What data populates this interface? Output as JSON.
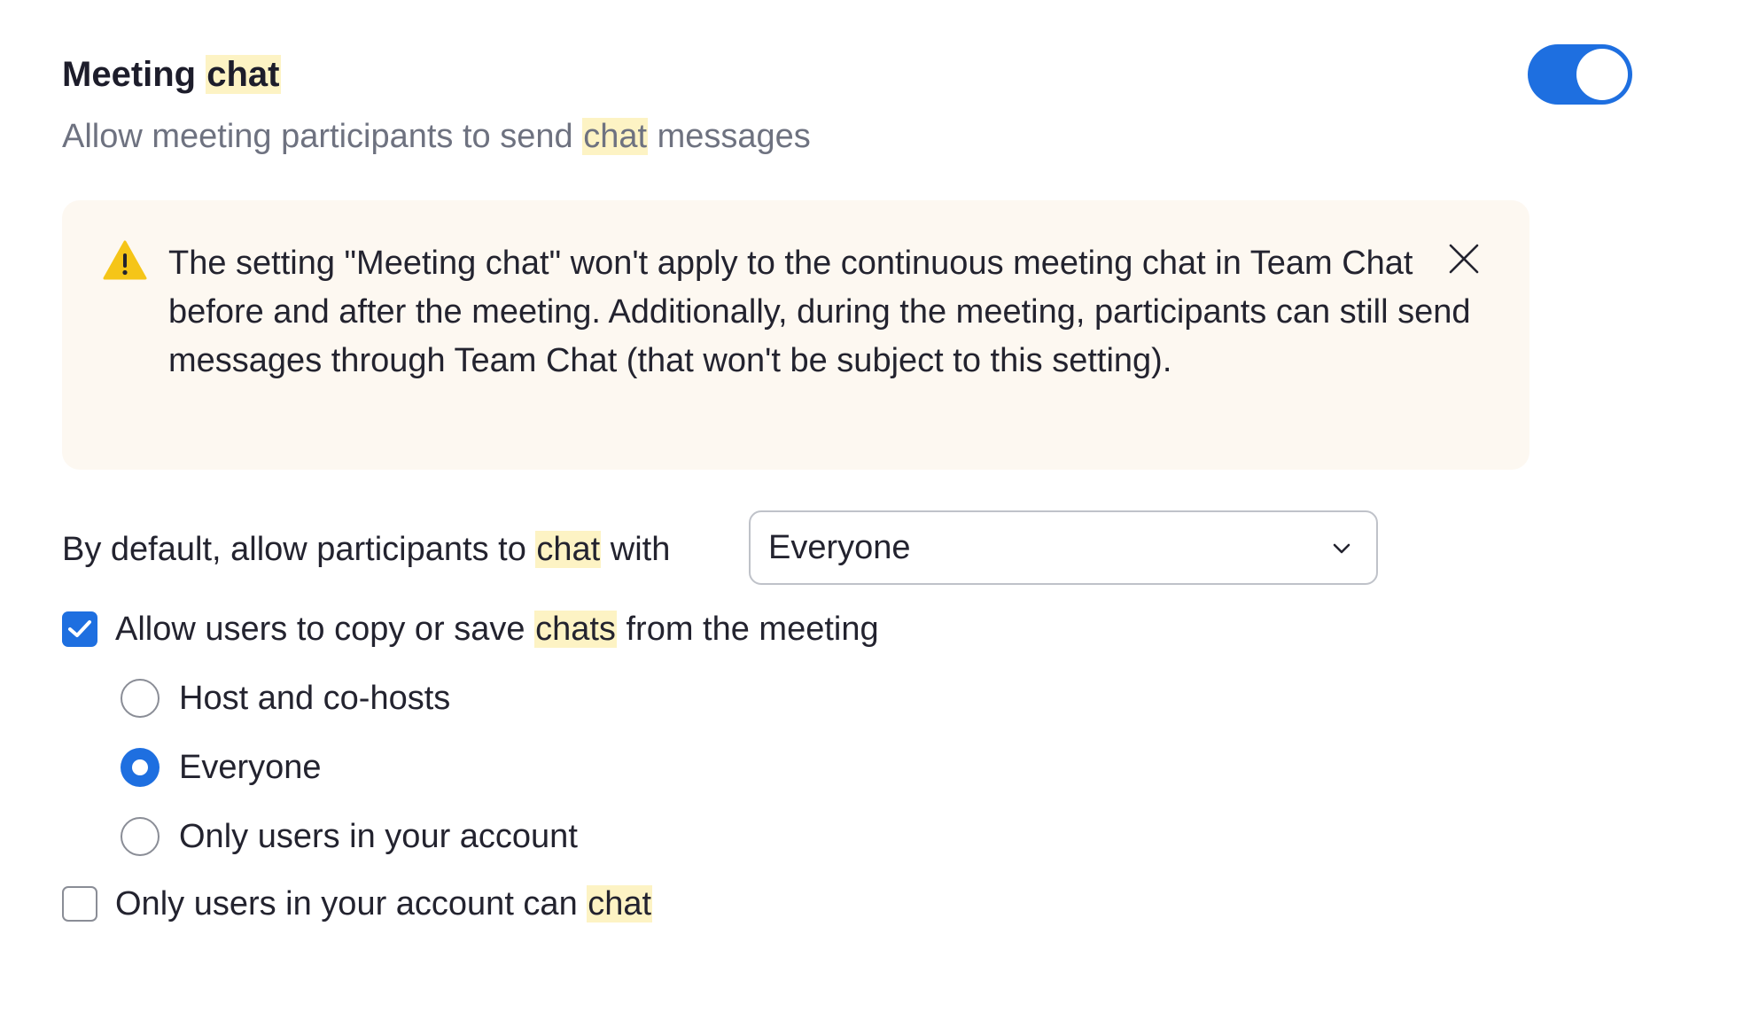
{
  "setting": {
    "title_prefix": "Meeting",
    "title_highlight": "chat",
    "description_prefix": "Allow meeting participants to send",
    "description_highlight": "chat",
    "description_suffix": "messages",
    "enabled": true
  },
  "notice": {
    "icon": "warning-icon",
    "text": "The setting \"Meeting chat\" won't apply to the continuous meeting chat in Team Chat before and after the meeting. Additionally, during the meeting, participants can still send messages through Team Chat (that won't be subject to this setting).",
    "close_icon": "close-icon"
  },
  "default_chat": {
    "label_prefix": "By default, allow participants to",
    "label_highlight": "chat",
    "label_suffix": "with",
    "selected": "Everyone"
  },
  "copy_save": {
    "checked": true,
    "label_prefix": "Allow users to copy or save",
    "label_highlight": "chats",
    "label_suffix": "from the meeting",
    "options": [
      {
        "label": "Host and co-hosts",
        "selected": false
      },
      {
        "label": "Everyone",
        "selected": true
      },
      {
        "label": "Only users in your account",
        "selected": false
      }
    ]
  },
  "account_only": {
    "checked": false,
    "label_prefix": "Only users in your account can",
    "label_highlight": "chat"
  },
  "colors": {
    "accent": "#1e6fe0",
    "highlight": "#fdf3c4",
    "notice_bg": "#fdf8f1",
    "warning": "#f5c518"
  }
}
